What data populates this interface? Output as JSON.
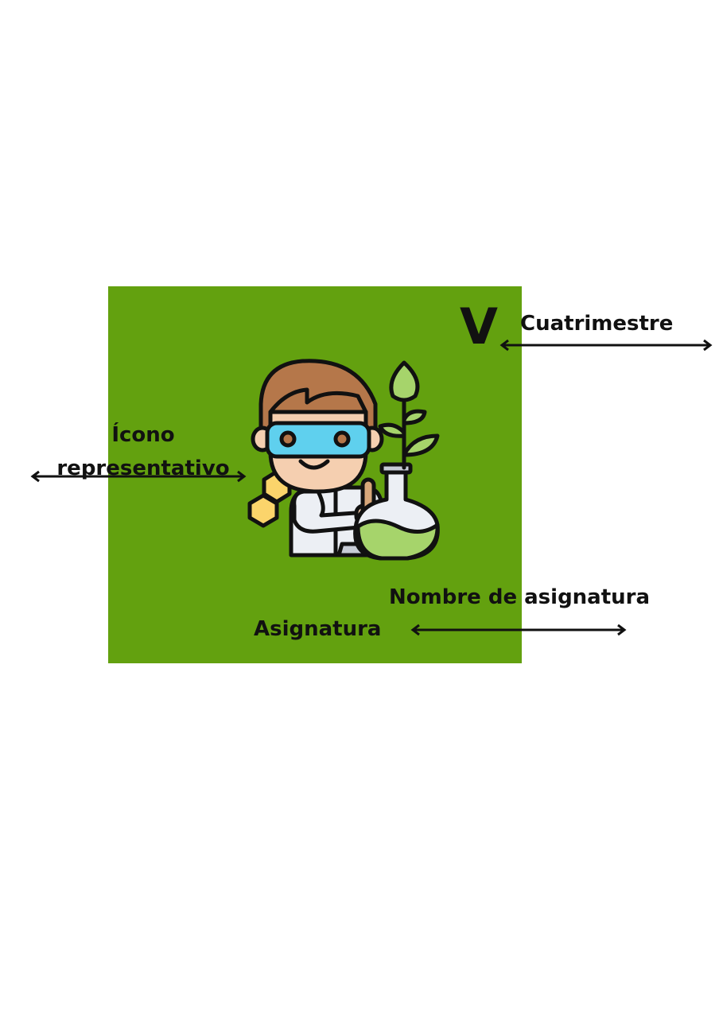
{
  "card": {
    "background": "#63a10f"
  },
  "semester": {
    "value": "V",
    "label": "Cuatrimestre"
  },
  "icon": {
    "name": "scientist-plant-flask-icon",
    "label_line1": "Ícono",
    "label_line2": "representativo"
  },
  "subject": {
    "name_label": "Nombre de asignatura",
    "value": "Asignatura"
  },
  "colors": {
    "green": "#63a10f",
    "text": "#111111",
    "hair": "#b5774a",
    "goggles": "#5fd0ee",
    "skin": "#f5cfb0",
    "leaf": "#a6d46b",
    "honeycomb": "#fbd46b"
  }
}
